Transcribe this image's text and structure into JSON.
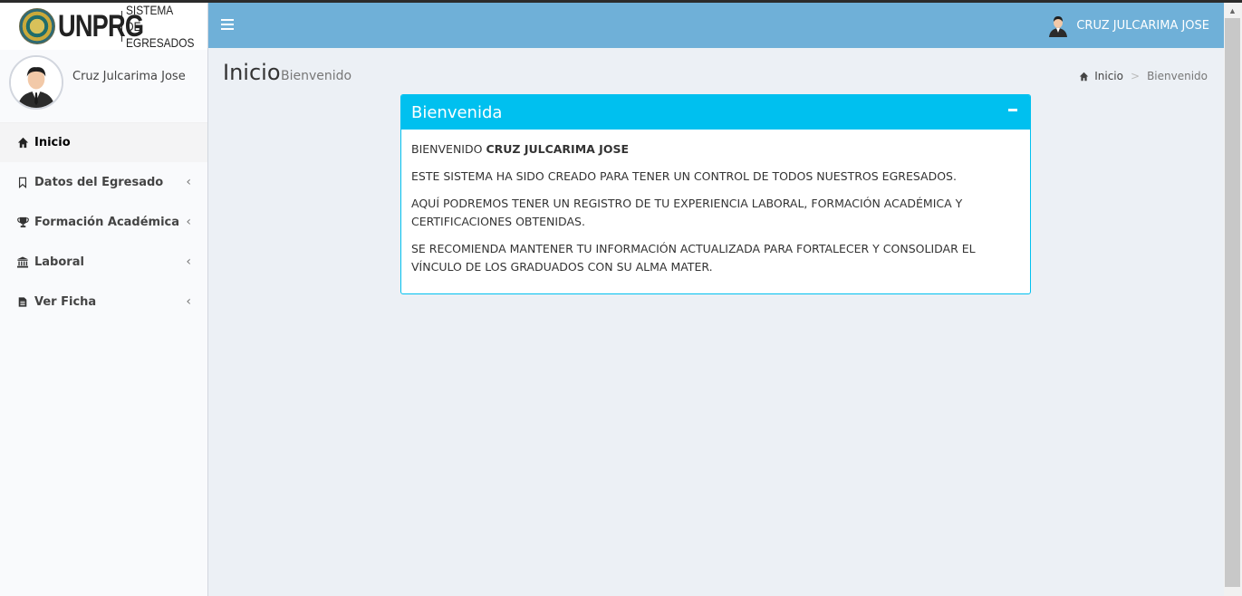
{
  "logo": {
    "main": "UNPRG",
    "sub_line1": "SISTEMA DE",
    "sub_line2": "EGRESADOS"
  },
  "sidebar": {
    "user_name": "Cruz Julcarima Jose",
    "items": [
      {
        "label": "Inicio",
        "icon": "home-icon",
        "active": true,
        "chevron": false
      },
      {
        "label": "Datos del Egresado",
        "icon": "bookmark-icon",
        "active": false,
        "chevron": true
      },
      {
        "label": "Formación Académica",
        "icon": "trophy-icon",
        "active": false,
        "chevron": true
      },
      {
        "label": "Laboral",
        "icon": "bank-icon",
        "active": false,
        "chevron": true
      },
      {
        "label": "Ver Ficha",
        "icon": "document-icon",
        "active": false,
        "chevron": true
      }
    ]
  },
  "header": {
    "user_name": "CRUZ JULCARIMA JOSE"
  },
  "content": {
    "title": "Inicio",
    "subtitle": "Bienvenido"
  },
  "breadcrumb": {
    "home": "Inicio",
    "separator": ">",
    "current": "Bienvenido"
  },
  "box": {
    "title": "Bienvenida",
    "greeting_prefix": "BIENVENIDO",
    "greeting_name": "CRUZ JULCARIMA JOSE",
    "p1": "ESTE SISTEMA HA SIDO CREADO PARA TENER UN CONTROL DE TODOS NUESTROS EGRESADOS.",
    "p2": "AQUÍ PODREMOS TENER UN REGISTRO DE TU EXPERIENCIA LABORAL, FORMACIÓN ACADÉMICA Y CERTIFICACIONES OBTENIDAS.",
    "p3": "SE RECOMIENDA MANTENER TU INFORMACIÓN ACTUALIZADA PARA FORTALECER Y CONSOLIDAR EL VÍNCULO DE LOS GRADUADOS CON SU ALMA MATER."
  },
  "colors": {
    "header": "#6fb0d8",
    "box_accent": "#00c0ef",
    "background": "#ecf0f5"
  }
}
